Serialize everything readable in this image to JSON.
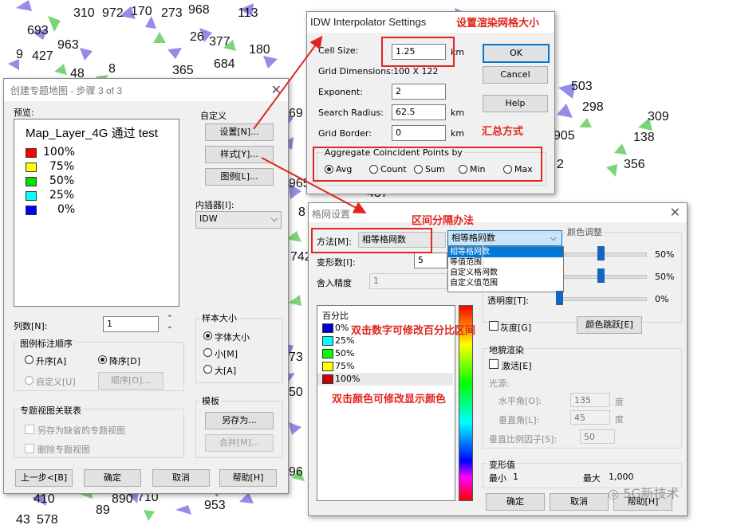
{
  "map": {
    "numbers": [
      "310",
      "972",
      "170",
      "273",
      "968",
      "113",
      "693",
      "963",
      "427",
      "9",
      "26",
      "377",
      "180",
      "48",
      "8",
      "684",
      "365",
      "503",
      "298",
      "309",
      "138",
      "905",
      "356",
      "2",
      "437",
      "965",
      "8",
      "742",
      "69",
      "73",
      "50",
      "96",
      "410",
      "89",
      "890",
      "710",
      "953",
      "43",
      "578"
    ]
  },
  "wizard": {
    "title": "创建专题地图 - 步骤 3 of 3",
    "preview_label": "预览:",
    "legend_title": "Map_Layer_4G 通过 test",
    "legend_items": [
      {
        "label": "100%",
        "color": "#ff0000"
      },
      {
        "label": "75%",
        "color": "#ffff00"
      },
      {
        "label": "50%",
        "color": "#00e000"
      },
      {
        "label": "25%",
        "color": "#00ffff"
      },
      {
        "label": "0%",
        "color": "#0000ff"
      }
    ],
    "custom_label": "自定义",
    "settings_btn": "设置[N]...",
    "style_btn": "样式[Y]...",
    "legend_btn": "图例[L]...",
    "interpolator_label": "内插器[I]:",
    "interpolator_value": "IDW",
    "columns_label": "列数[N]:",
    "columns_value": "1",
    "legend_order_label": "图例标注顺序",
    "asc_label": "升序[A]",
    "desc_label": "降序[D]",
    "custom_order_label": "自定义[U]",
    "order_btn": "顺序[O]...",
    "sample_size_label": "样本大小",
    "font_size_label": "字体大小",
    "small_label": "小[M]",
    "large_label": "大[A]",
    "template_label": "模板",
    "save_as_btn": "另存为...",
    "merge_btn": "合并[M]...",
    "assoc_label": "专题视图关联表",
    "save_default_label": "另存为缺省的专题视图",
    "delete_view_label": "删除专题视图",
    "prev_btn": "上一步<[B]",
    "ok_btn": "确定",
    "cancel_btn": "取消",
    "help_btn": "帮助[H]"
  },
  "idw": {
    "title": "IDW Interpolator Settings",
    "cell_size_label": "Cell Size:",
    "cell_size_value": "1.25",
    "cell_unit": "km",
    "grid_dim_label": "Grid Dimensions:",
    "grid_dim_value": "100 X 122",
    "exponent_label": "Exponent:",
    "exponent_value": "2",
    "search_radius_label": "Search Radius:",
    "search_radius_value": "62.5",
    "search_unit": "km",
    "grid_border_label": "Grid Border:",
    "grid_border_value": "0",
    "border_unit": "km",
    "ok_btn": "OK",
    "cancel_btn": "Cancel",
    "help_btn": "Help",
    "aggregate_label": "Aggregate Coincident Points by",
    "aggregate_options": [
      "Avg",
      "Count",
      "Sum",
      "Min",
      "Max"
    ],
    "aggregate_selected": "Avg"
  },
  "grid": {
    "title": "格网设置",
    "method_label": "方法[M]:",
    "method_value": "相等格网数",
    "dropdown_selected": "相等格网数",
    "dropdown_options": [
      "相等格网数",
      "等值范围",
      "自定义格网数",
      "自定义值范围"
    ],
    "inflection_label": "变形数[I]:",
    "inflection_value": "5",
    "rounding_label": "舍入精度",
    "rounding_value": "1",
    "percent_label": "百分比",
    "percent_items": [
      {
        "label": "0%",
        "color": "#0000cc"
      },
      {
        "label": "25%",
        "color": "#00ffff"
      },
      {
        "label": "50%",
        "color": "#00ff00"
      },
      {
        "label": "75%",
        "color": "#ffff00"
      },
      {
        "label": "100%",
        "color": "#cc0000"
      }
    ],
    "color_adjust_label": "颜色调整",
    "pct1": "50%",
    "pct2": "50%",
    "transparency_label": "透明度[T]:",
    "transparency_value": "0%",
    "grayscale_label": "灰度[G]",
    "color_jump_btn": "颜色跳跃[E]",
    "relief_label": "地貌渲染",
    "activate_label": "激活[E]",
    "light_label": "光源:",
    "azimuth_label": "水平角[O]:",
    "azimuth_value": "135",
    "degree1": "度",
    "elevation_label": "垂直角[L]:",
    "elevation_value": "45",
    "degree2": "度",
    "vscale_label": "垂直比例因子[S]:",
    "vscale_value": "50",
    "inflection_value_label": "变形值",
    "min_label": "最小",
    "min_value": "1",
    "max_label": "最大",
    "max_value": "1,000",
    "ok_btn": "确定",
    "cancel_btn": "取消",
    "help_btn": "帮助[H]"
  },
  "annotations": {
    "set_render_grid": "设置渲染网格大小",
    "aggregate_method": "汇总方式",
    "interval_method": "区间分隔办法",
    "dblclick_number": "双击数字可修改百分比区间",
    "dblclick_color": "双击颜色可修改显示颜色"
  },
  "watermark": "5G新技术",
  "colors": {
    "annotation_red": "#e0261f",
    "sector_purple": "#8a7fe6",
    "sector_green": "#6fd06a",
    "selection_blue": "#0078d7"
  }
}
